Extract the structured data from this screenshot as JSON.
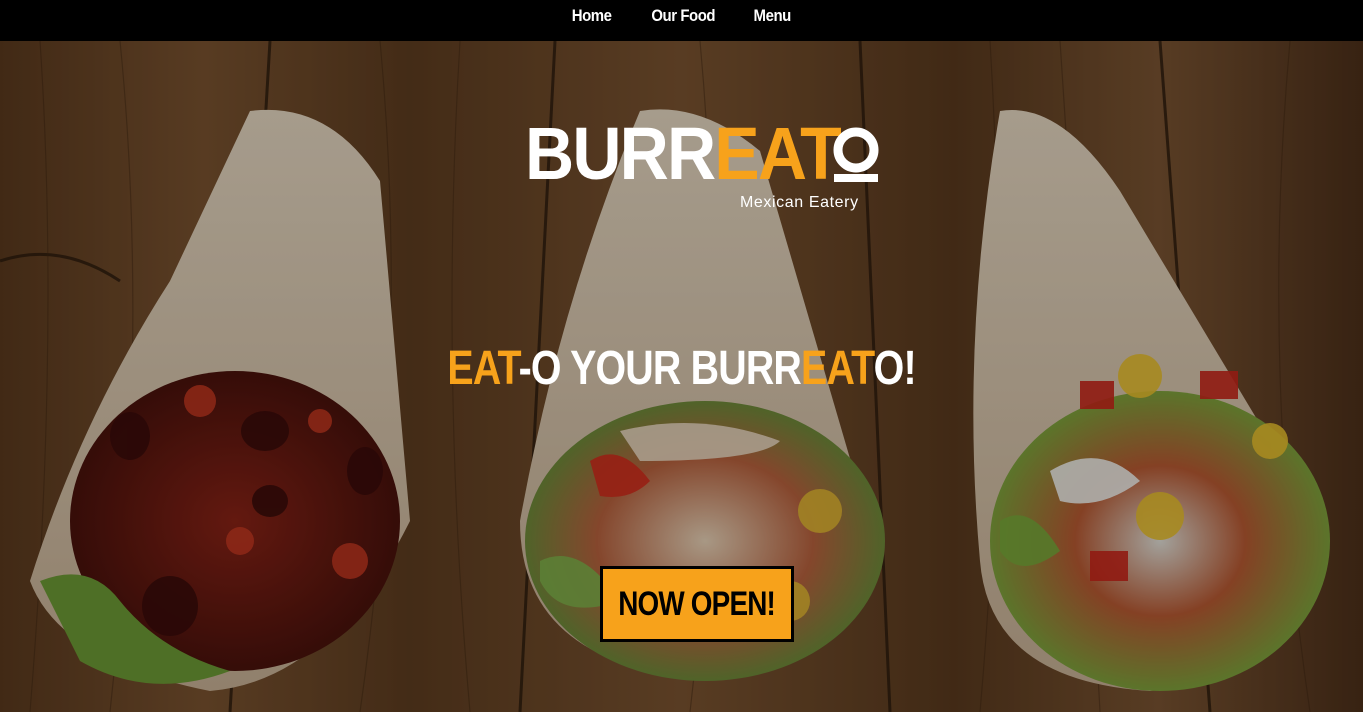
{
  "nav": {
    "items": [
      {
        "label": "Home"
      },
      {
        "label": "Our Food"
      },
      {
        "label": "Menu"
      }
    ]
  },
  "brand": {
    "name_white_1": "BURR",
    "name_orange": "EAT",
    "name_o": "O",
    "subtitle": "Mexican Eatery"
  },
  "hero": {
    "tagline_part1": "EAT",
    "tagline_part2": "-O YOUR BURR",
    "tagline_part3": "EAT",
    "tagline_part4": "O!",
    "cta_label": "NOW OPEN!"
  },
  "colors": {
    "accent": "#f7a21b",
    "nav_bg": "#000000",
    "text_light": "#ffffff"
  },
  "icons": {
    "logo_o": "circle-o-logo-mark"
  }
}
